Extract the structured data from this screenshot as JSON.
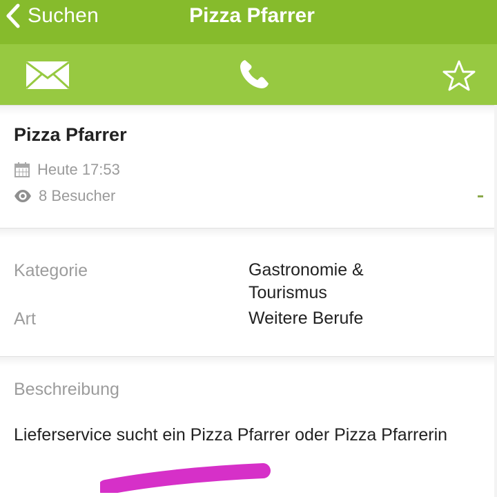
{
  "nav": {
    "back_label": "Suchen",
    "title": "Pizza Pfarrer",
    "back_icon": "chevron-left-icon"
  },
  "actions": {
    "mail_icon": "mail-icon",
    "phone_icon": "phone-icon",
    "favorite_icon": "star-icon"
  },
  "listing": {
    "title": "Pizza Pfarrer",
    "date": "Heute 17:53",
    "visitors": "8 Besucher"
  },
  "details": {
    "category_label": "Kategorie",
    "category_value_line1": "Gastronomie &",
    "category_value_line2": "Tourismus",
    "type_label": "Art",
    "type_value": "Weitere Berufe"
  },
  "description": {
    "label": "Beschreibung",
    "text": "Lieferservice sucht ein Pizza Pfarrer oder Pizza Pfarrerin"
  },
  "colors": {
    "navbar": "#86bb2c",
    "actionbar": "#97c941",
    "highlight_marker": "#d630c8"
  }
}
